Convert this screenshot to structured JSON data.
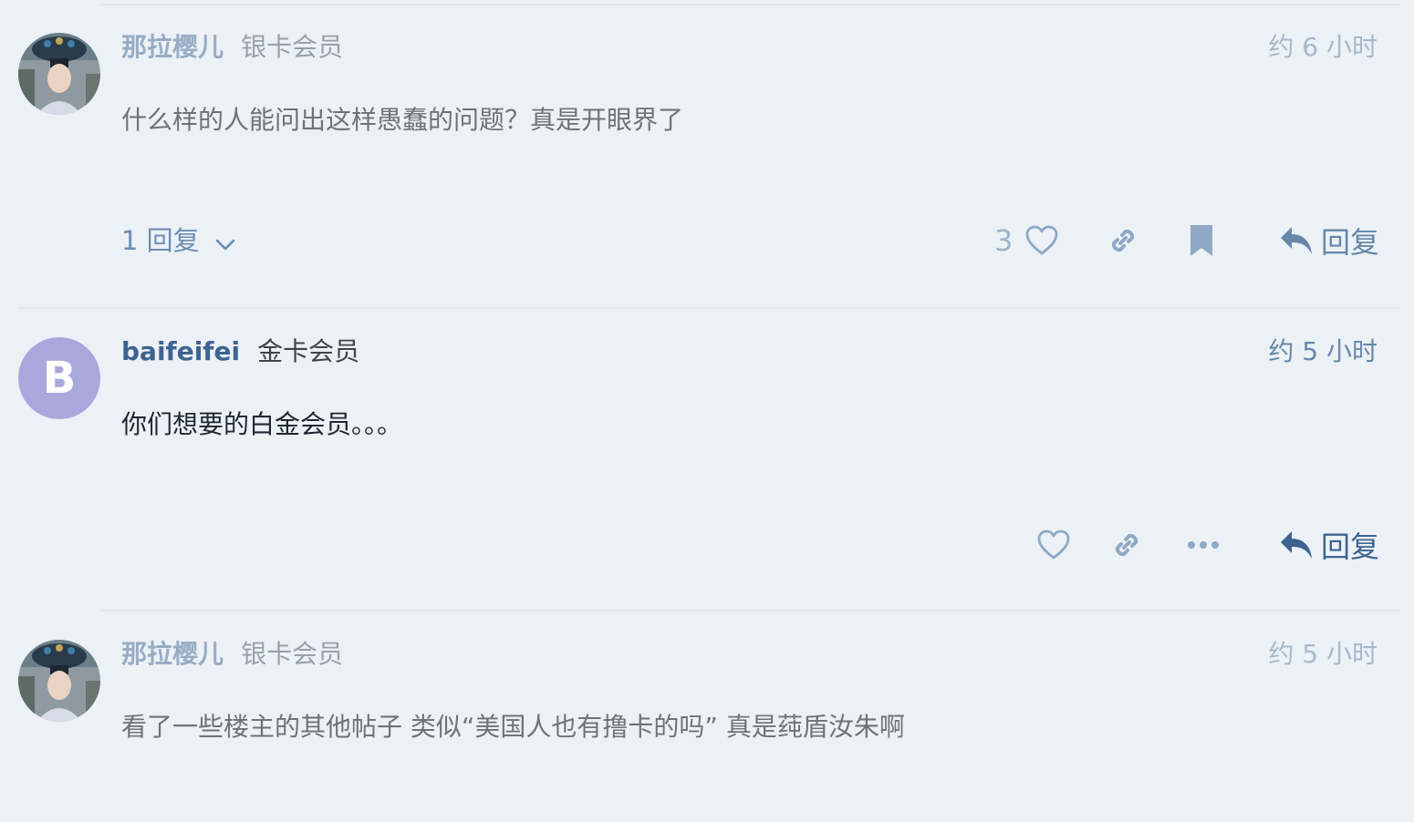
{
  "posts": [
    {
      "username": "那拉樱儿",
      "user_title": "银卡会员",
      "time": "约 6 小时",
      "content": "什么样的人能问出这样愚蠢的问题？真是开眼界了",
      "replies_label": "1 回复",
      "like_count": "3",
      "reply_label": "回复",
      "avatar": "portrait-photo"
    },
    {
      "username": "baifeifei",
      "user_title": "金卡会员",
      "time": "约 5 小时",
      "content": "你们想要的白金会员。。。",
      "reply_label": "回复",
      "avatar_letter": "B",
      "avatar_color": "#a9a8dc"
    },
    {
      "username": "那拉樱儿",
      "user_title": "银卡会员",
      "time": "约 5 小时",
      "content": "看了一些楼主的其他帖子 类似“美国人也有撸卡的吗” 真是莼盾汝朱啊",
      "avatar": "portrait-photo"
    }
  ],
  "colors": {
    "background": "#ecf1f6",
    "link": "#3d6390",
    "faded_link": "#98acc4",
    "icon": "#8ea8c5",
    "reply_button": "#4a6c95"
  }
}
